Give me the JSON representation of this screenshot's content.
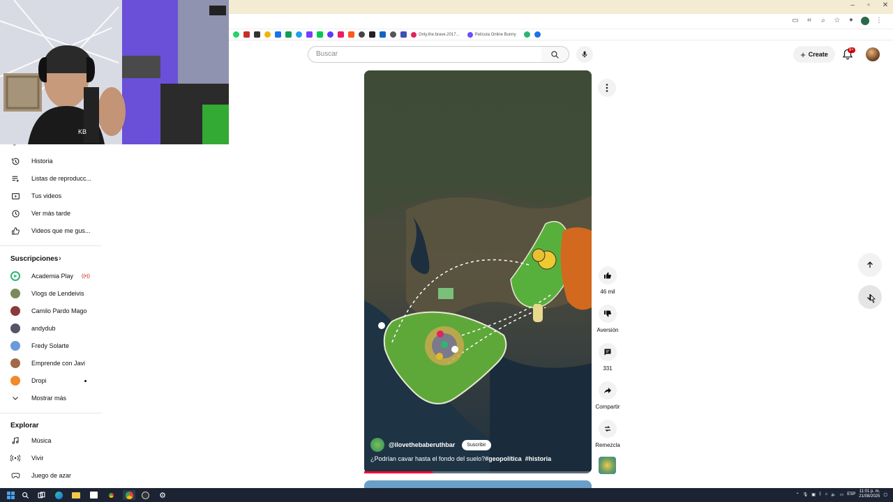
{
  "browser": {
    "window_controls": [
      "–",
      "▫",
      "✕"
    ],
    "bookmarks": [
      {
        "label": "Only.the.brave.2017...",
        "color": "#e0245e"
      },
      {
        "label": "Película Online Bunny",
        "color": "#6b4eff"
      }
    ],
    "bookmark_colors": [
      "#25d366",
      "#c4302b",
      "#333333",
      "#f4b400",
      "#1a73e8",
      "#0f9d58",
      "#1da1f2",
      "#7a3cff",
      "#00c853",
      "#5a3cff",
      "#e91e63",
      "#ff5722",
      "#444444",
      "#222222",
      "#1565c0",
      "#555555",
      "#3f51b5"
    ]
  },
  "header": {
    "search_placeholder": "Buscar",
    "create_label": "Create",
    "notification_badge": "9+"
  },
  "sidebar": {
    "you_items": [
      {
        "label": "Historia",
        "icon": "history-icon"
      },
      {
        "label": "Listas de reproducc...",
        "icon": "playlist-icon"
      },
      {
        "label": "Tus videos",
        "icon": "your-videos-icon"
      },
      {
        "label": "Ver más tarde",
        "icon": "watch-later-icon"
      },
      {
        "label": "Videos que me gus...",
        "icon": "thumb-up-icon"
      }
    ],
    "subscriptions_title": "Suscripciones",
    "subscriptions": [
      {
        "label": "Academia Play",
        "color": "#2bb673",
        "live": true
      },
      {
        "label": "Vlogs de Lendeivis",
        "color": "#7a8a5a"
      },
      {
        "label": "Camilo Pardo Mago",
        "color": "#8a3a3a"
      },
      {
        "label": "andydub",
        "color": "#555566"
      },
      {
        "label": "Fredy Solarte",
        "color": "#6a9ad8"
      },
      {
        "label": "Emprende con Javi",
        "color": "#a06a4a"
      },
      {
        "label": "Dropi",
        "color": "#f08a2a",
        "dot": true
      }
    ],
    "show_more": "Mostrar más",
    "explore_title": "Explorar",
    "explore": [
      {
        "label": "Música",
        "icon": "music-icon"
      },
      {
        "label": "Vivir",
        "icon": "live-icon"
      },
      {
        "label": "Juego de azar",
        "icon": "gaming-icon"
      }
    ]
  },
  "short": {
    "channel": "@ilovethebaberuthbar",
    "subscribe": "Suscribir",
    "caption_text": "¿Podrían cavar hasta el fondo del suelo?",
    "hashtag1": "#geopolítica",
    "hashtag2": "#historia",
    "progress": 0.3
  },
  "actions": {
    "likes": "46 mil",
    "dislike": "Aversión",
    "comments": "331",
    "share": "Compartir",
    "remix": "Remezcla"
  },
  "taskbar": {
    "lang": "ESP",
    "time": "11:01 p. m.",
    "date": "21/08/2025"
  }
}
